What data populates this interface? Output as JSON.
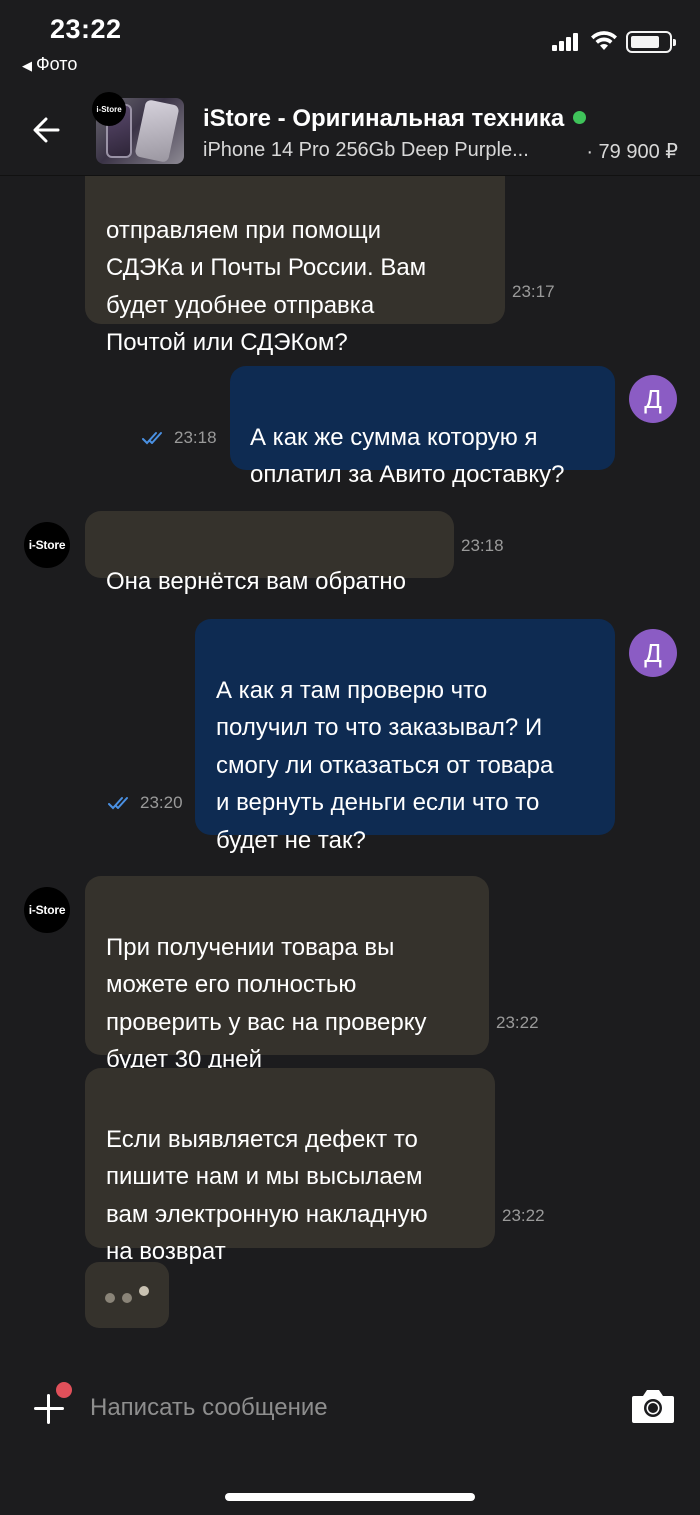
{
  "status_bar": {
    "time": "23:22",
    "back_app": "Фото"
  },
  "header": {
    "title": "iStore - Оригинальная техника",
    "subtitle": "iPhone 14 Pro 256Gb Deep Purple...",
    "price": "· 79 900 ₽",
    "logo_text": "i-Store"
  },
  "messages": [
    {
      "dir": "in",
      "text": "отправляем при помощи\nСДЭКа и Почты России. Вам\nбудет удобнее отправка\nПочтой или СДЭКом?",
      "time": "23:17"
    },
    {
      "dir": "out",
      "text": "А как же сумма которую я\nоплатил за Авито доставку?",
      "time": "23:18",
      "avatar": "Д"
    },
    {
      "dir": "in",
      "text": "Она вернётся вам обратно",
      "time": "23:18",
      "avatar": "i-Store"
    },
    {
      "dir": "out",
      "text": "А как я там проверю что\nполучил то что заказывал? И\nсмогу ли отказаться от товара\nи вернуть деньги если что то\nбудет не так?",
      "time": "23:20",
      "avatar": "Д"
    },
    {
      "dir": "in",
      "text": "При получении товара вы\nможете его полностью\nпроверить у вас на проверку\nбудет 30 дней",
      "time": "23:22",
      "avatar": "i-Store"
    },
    {
      "dir": "in",
      "text": "Если выявляется дефект то\nпишите нам и мы высылаем\nвам электронную накладную\nна возврат",
      "time": "23:22"
    }
  ],
  "composer": {
    "placeholder": "Написать сообщение"
  },
  "colors": {
    "incoming_bubble": "#35322c",
    "outgoing_bubble": "#0e2b52",
    "online": "#3fc35a",
    "avatar_user": "#8b5cc4",
    "read_checks": "#4a90e2"
  }
}
